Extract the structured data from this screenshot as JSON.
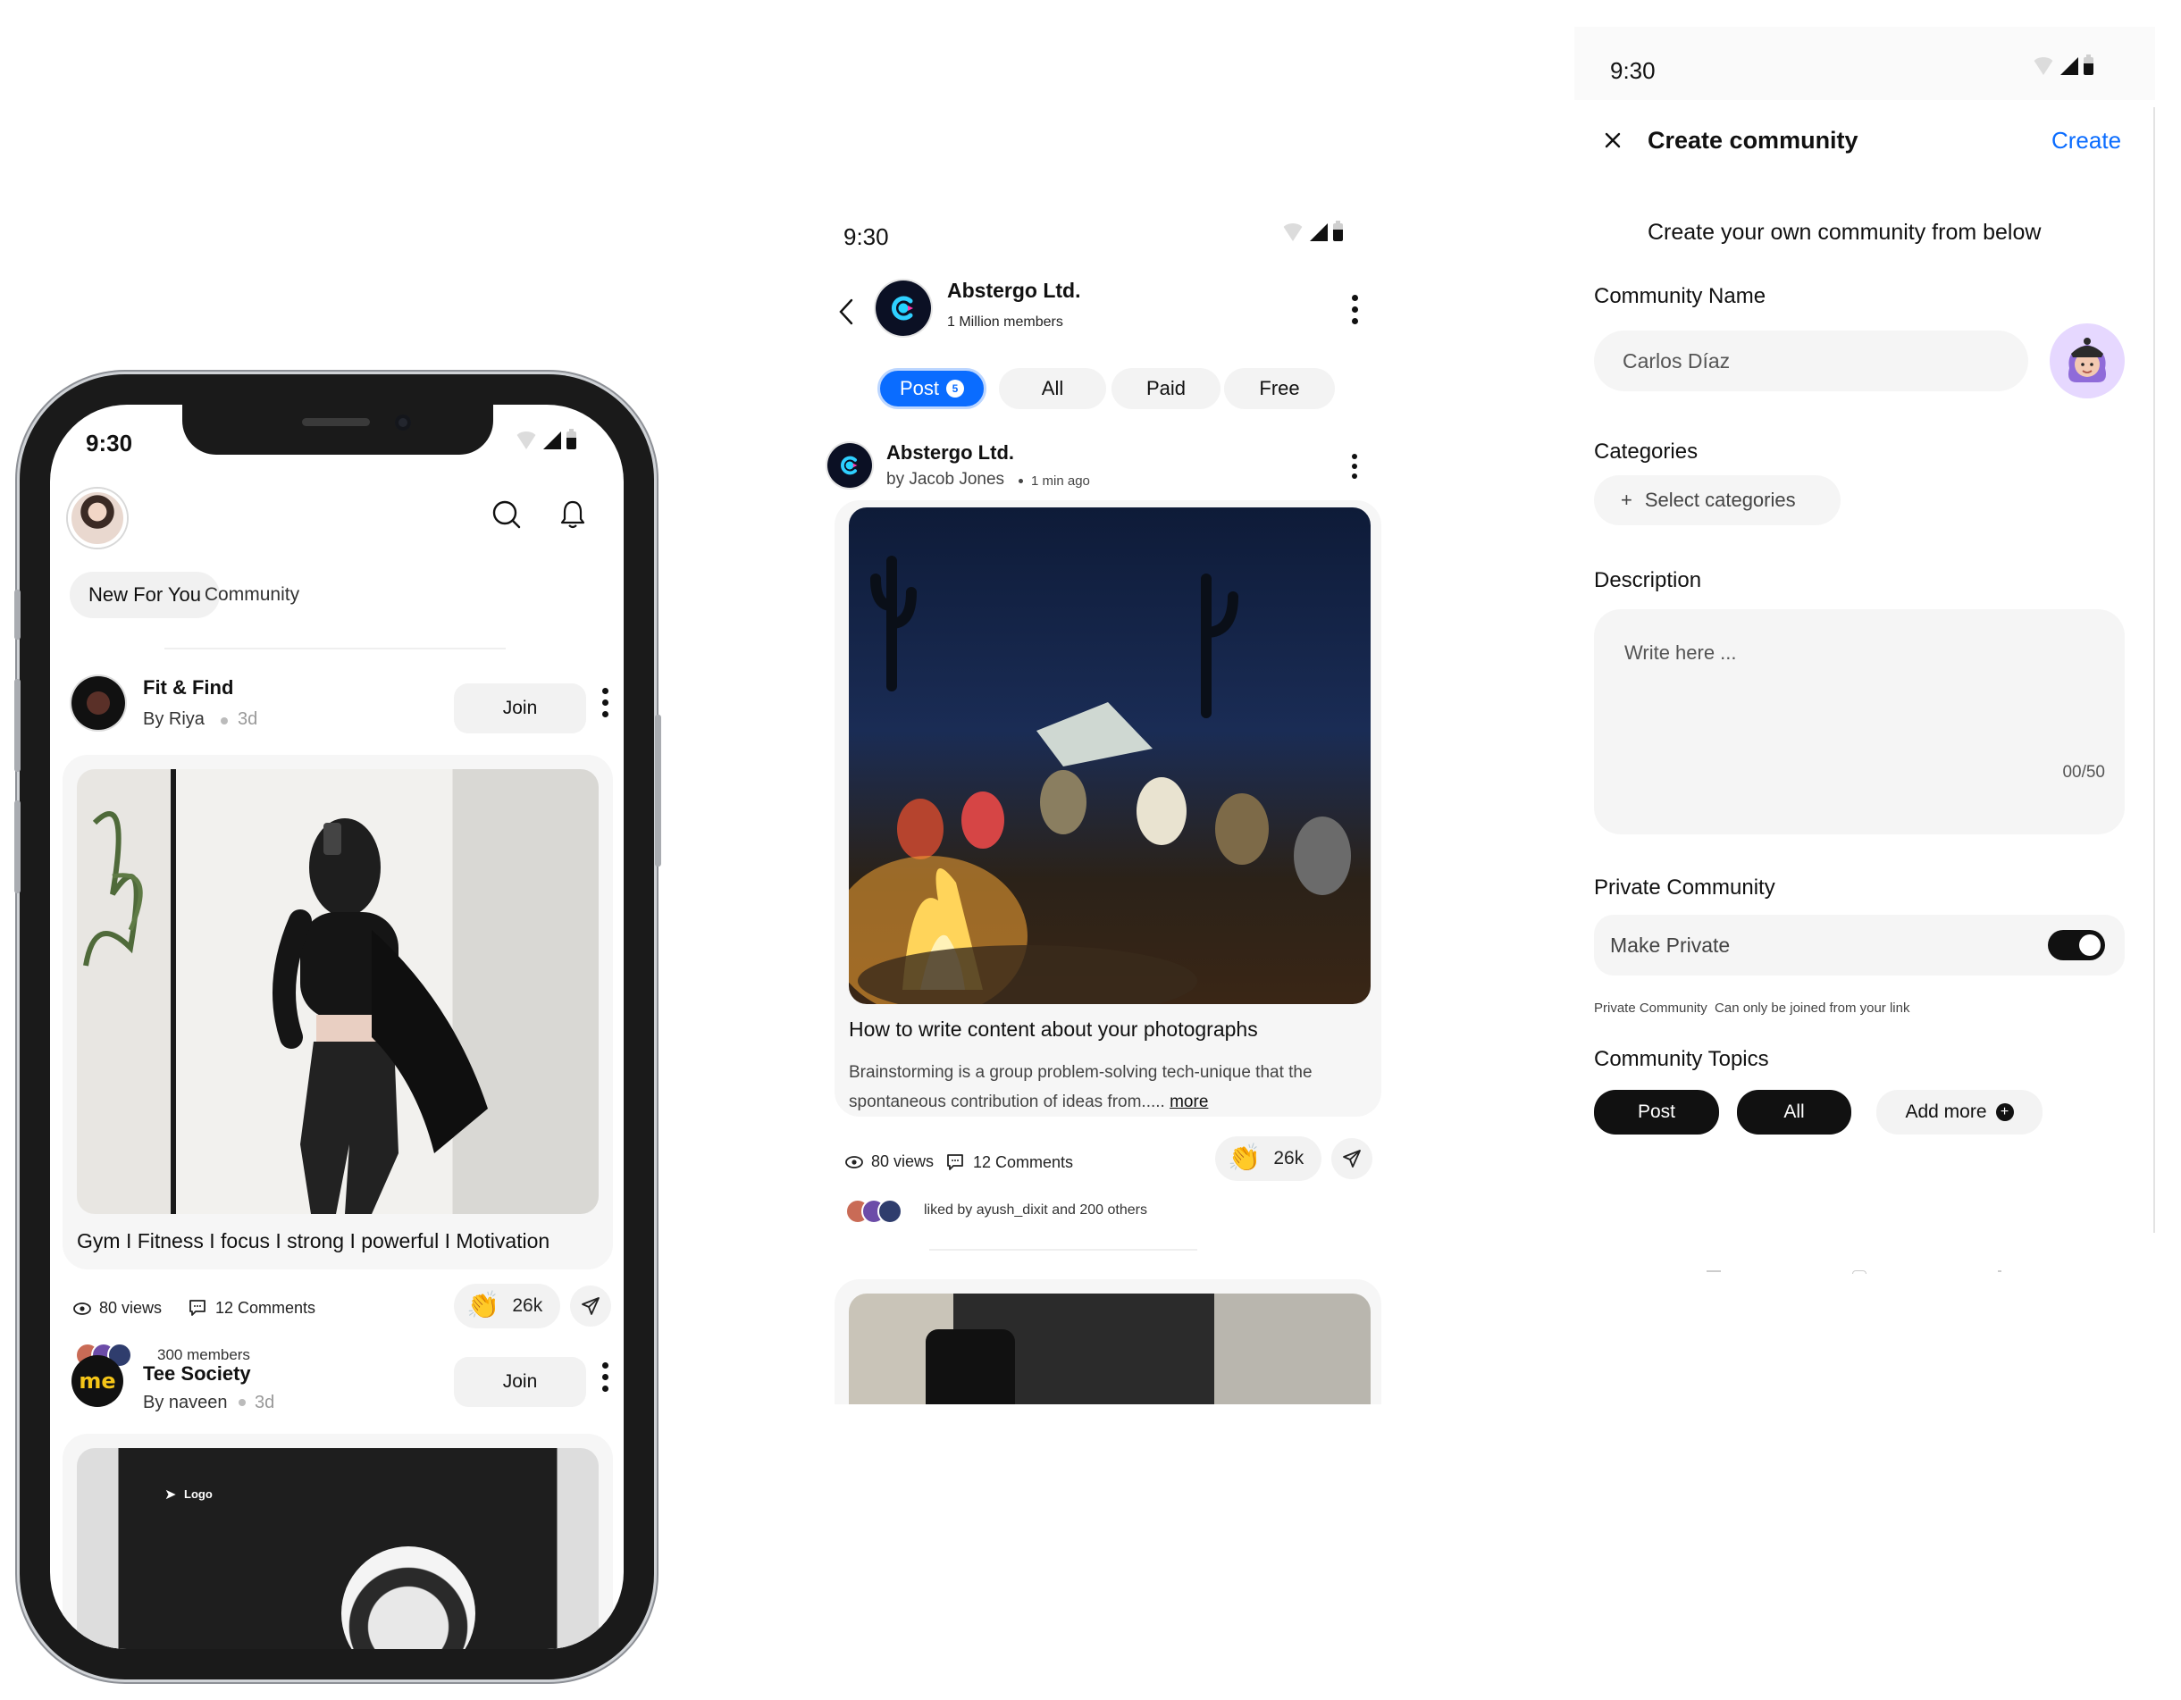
{
  "phone1": {
    "status_time": "9:30",
    "tabs": [
      {
        "label": "New For You"
      },
      {
        "label": "Community"
      }
    ],
    "posts": [
      {
        "community": "Fit & Find",
        "by": "By Riya",
        "age": "3d",
        "join_label": "Join",
        "caption": "Gym I Fitness I focus I strong I powerful I Motivation",
        "views": "80 views",
        "comments": "12 Comments",
        "claps": "26k",
        "members": "300 members"
      },
      {
        "community": "Tee Society",
        "by": "By naveen",
        "age": "3d",
        "join_label": "Join",
        "preview_logo_text": "Logo"
      }
    ],
    "logo_glyph": "me"
  },
  "phone2": {
    "status_time": "9:30",
    "community_name": "Abstergo Ltd.",
    "members": "1 Million members",
    "filters": [
      {
        "label": "Post",
        "badge": "5"
      },
      {
        "label": "All"
      },
      {
        "label": "Paid"
      },
      {
        "label": "Free"
      }
    ],
    "post": {
      "author_name": "Abstergo Ltd.",
      "by": "by Jacob Jones",
      "time": "1 min ago",
      "title": "How to write content about your photographs",
      "body": "Brainstorming is a group problem-solving tech-unique that the spontaneous contribution of ideas from.....",
      "more": "more",
      "views": "80 views",
      "comments": "12 Comments",
      "claps": "26k",
      "liked_by": "liked by ayush_dixit and 200 others"
    }
  },
  "phone3": {
    "status_time": "9:30",
    "title": "Create community",
    "create_label": "Create",
    "subtitle": "Create your own community from below",
    "name_label": "Community Name",
    "name_value": "Carlos Díaz",
    "categories_label": "Categories",
    "categories_button": "Select categories",
    "description_label": "Description",
    "description_placeholder": "Write here ...",
    "description_counter": "00/50",
    "private_label": "Private Community",
    "make_private_label": "Make Private",
    "private_on": true,
    "private_hint": "Private Community  Can only be joined from your link",
    "topics_label": "Community Topics",
    "topics": [
      "Post",
      "All"
    ],
    "add_more": "Add more"
  },
  "colors": {
    "accent_blue": "#0a6cff",
    "dark": "#111111",
    "surface": "#f5f5f5"
  }
}
